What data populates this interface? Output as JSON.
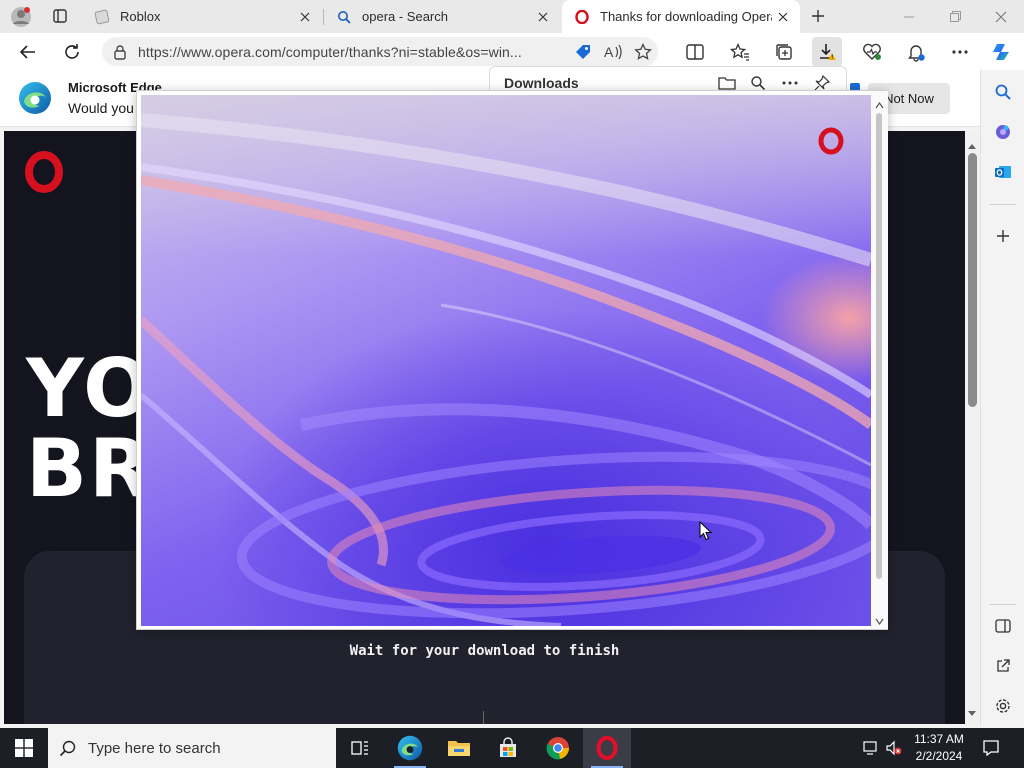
{
  "tabs": [
    {
      "title": "Roblox",
      "icon": "roblox-icon",
      "active": false
    },
    {
      "title": "opera - Search",
      "icon": "search-icon",
      "active": false
    },
    {
      "title": "Thanks for downloading Opera",
      "icon": "opera-icon",
      "active": true
    }
  ],
  "address": {
    "url": "https://www.opera.com/computer/thanks?ni=stable&os=win..."
  },
  "infobar": {
    "title": "Microsoft Edge",
    "text": "Would you",
    "not_now_label": "Not Now"
  },
  "downloads": {
    "title": "Downloads"
  },
  "page": {
    "hero_line1": "YO",
    "hero_line2": "BR",
    "wait_text": "Wait for your download to finish"
  },
  "taskbar": {
    "search_placeholder": "Type here to search",
    "time": "11:37 AM",
    "date": "2/2/2024"
  },
  "colors": {
    "opera_red": "#d6101f",
    "page_bg": "#14141f",
    "installer_purple": "#7b5cf0"
  }
}
